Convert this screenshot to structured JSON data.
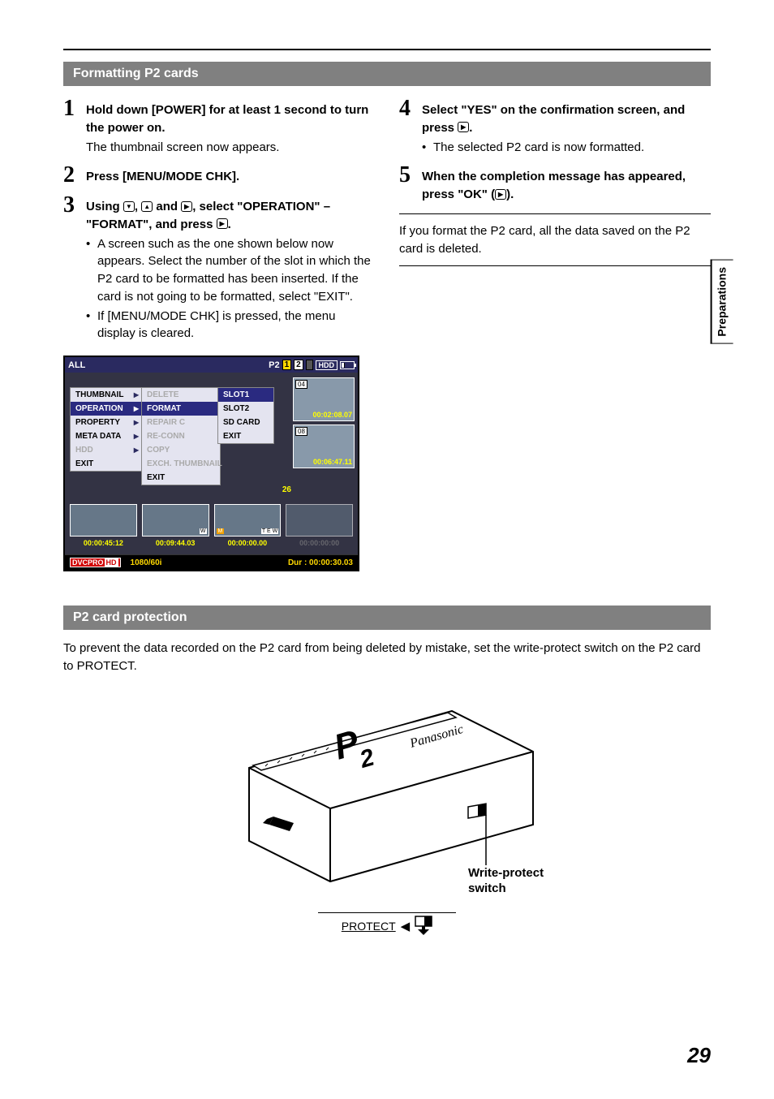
{
  "side_tab": "Preparations",
  "page_number": "29",
  "section1": {
    "title": "Formatting P2 cards",
    "steps_left": [
      {
        "num": "1",
        "bold": "Hold down [POWER] for at least 1 second to turn the power on.",
        "plain": "The thumbnail screen now appears."
      },
      {
        "num": "2",
        "bold": "Press [MENU/MODE CHK]."
      },
      {
        "num": "3",
        "bold_parts": [
          "Using ",
          ", ",
          " and ",
          ", select \"OPERATION\" – \"FORMAT\", and press ",
          "."
        ],
        "icons": [
          "▼",
          "▲",
          "▶",
          "▶"
        ],
        "bullets": [
          "A screen such as the one shown below now appears. Select the number of the slot in which the P2 card to be formatted has been inserted. If the card is not going to be formatted, select \"EXIT\".",
          "If [MENU/MODE CHK] is pressed, the menu display is cleared."
        ]
      }
    ],
    "steps_right": [
      {
        "num": "4",
        "bold_parts": [
          "Select \"YES\" on the confirmation screen, and press ",
          "."
        ],
        "icons": [
          "▶"
        ],
        "bullets": [
          "The selected P2 card is now formatted."
        ]
      },
      {
        "num": "5",
        "bold_parts": [
          "When the completion message has appeared, press \"OK\" (",
          ")."
        ],
        "icons": [
          "▶"
        ]
      }
    ],
    "note_right": "If you format the P2 card, all the data saved on the P2 card is deleted."
  },
  "screenshot": {
    "top_left": "ALL",
    "top_right_label": "P2",
    "slot_yellow": "1",
    "slot_gray": "2",
    "hdd_label": "HDD",
    "menu1": [
      {
        "label": "THUMBNAIL",
        "arr": true
      },
      {
        "label": "OPERATION",
        "arr": true,
        "sel": true
      },
      {
        "label": "PROPERTY",
        "arr": true
      },
      {
        "label": "META DATA",
        "arr": true
      },
      {
        "label": "HDD",
        "arr": true,
        "dim": true
      },
      {
        "label": "EXIT"
      }
    ],
    "menu2": [
      {
        "label": "DELETE",
        "dim": true
      },
      {
        "label": "FORMAT",
        "sel": true
      },
      {
        "label": "REPAIR C",
        "dim": true
      },
      {
        "label": "RE-CONN",
        "dim": true
      },
      {
        "label": "COPY",
        "dim": true
      },
      {
        "label": "EXCH. THUMBNAIL",
        "dim": true
      },
      {
        "label": "EXIT"
      }
    ],
    "menu3": [
      {
        "label": "SLOT1",
        "sel": true
      },
      {
        "label": "SLOT2"
      },
      {
        "label": "SD CARD"
      },
      {
        "label": "EXIT"
      }
    ],
    "thumbs": [
      {
        "tag": "04",
        "tc": "00:02:08.07"
      },
      {
        "tag": "08",
        "tc": "00:06:47.11"
      }
    ],
    "bottom_thumbs": [
      {
        "tc": "00:00:45:12"
      },
      {
        "tc": "00:09:44.03",
        "flag": "W"
      },
      {
        "tc": "00:00:00.00",
        "flag_m": "M",
        "flag": "T E W"
      },
      {
        "tc": "00:00:00:00",
        "dim": true
      }
    ],
    "corner_num": "26",
    "footer": {
      "badge": "DVCPRO",
      "badge_hd": "HD",
      "format": "1080/60i",
      "dur": "Dur : 00:00:30.03"
    }
  },
  "section2": {
    "title": "P2 card protection",
    "text": "To prevent the data recorded on the P2 card from being deleted by mistake, set the write-protect switch on the P2 card to PROTECT.",
    "card_brand": "Panasonic",
    "card_logo": "P2",
    "write_label_line1": "Write-protect",
    "write_label_line2": "switch",
    "protect_label": "PROTECT"
  }
}
